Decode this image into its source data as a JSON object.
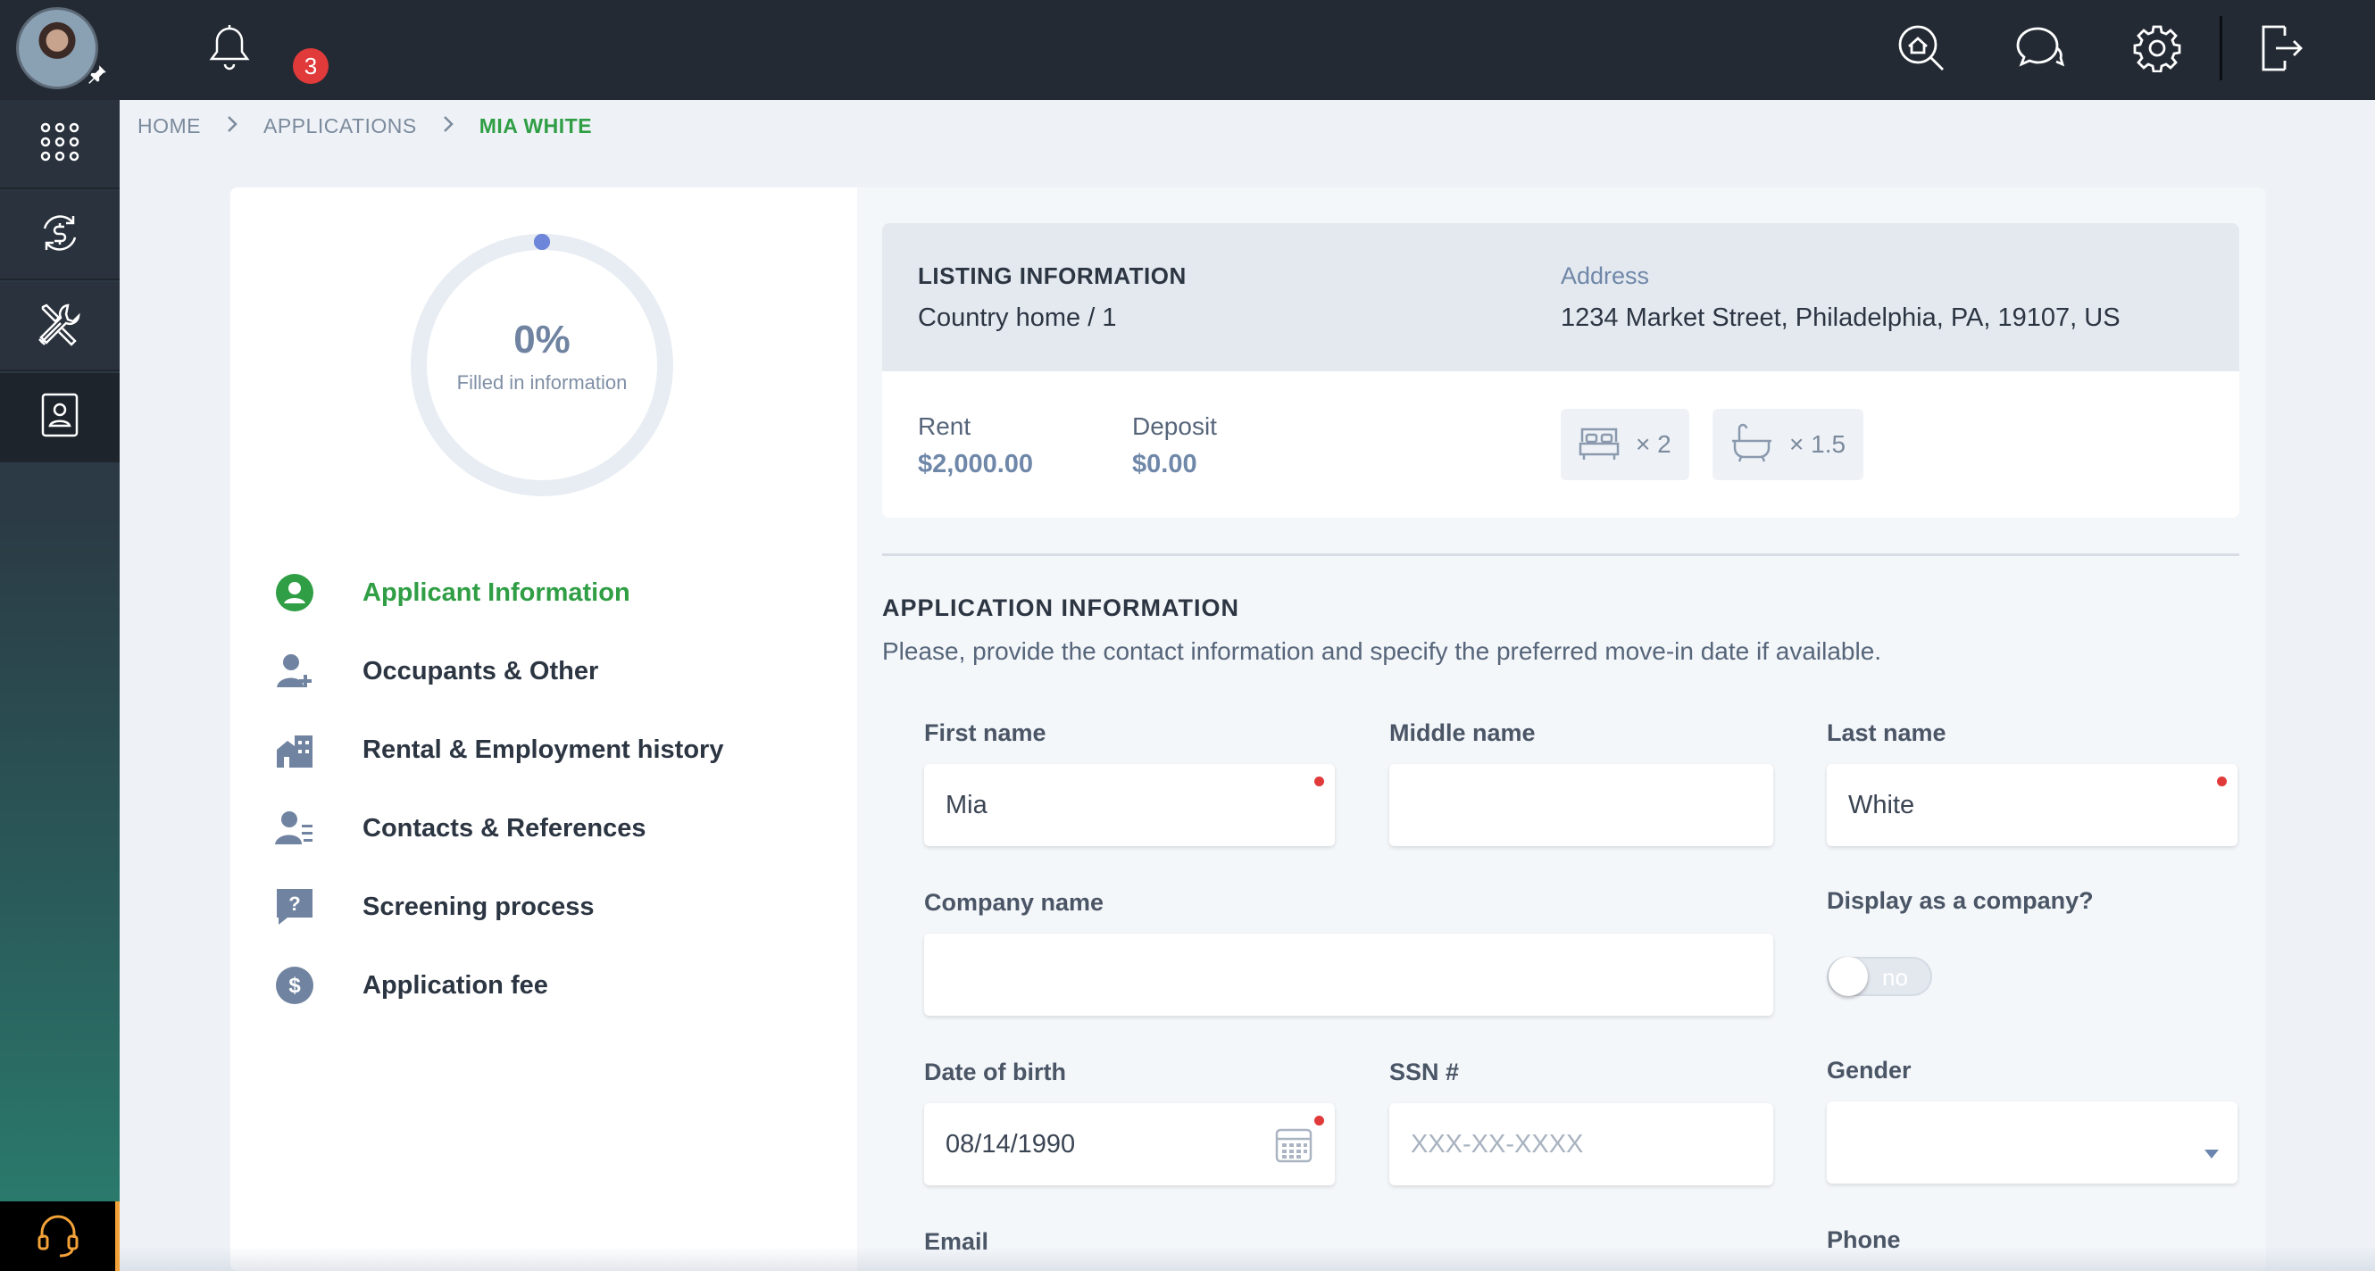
{
  "topbar": {
    "notifications_count": "3",
    "icons": [
      "bell-icon",
      "house-search-icon",
      "chat-icon",
      "gear-icon",
      "logout-icon"
    ]
  },
  "sidebar": {
    "items": [
      "apps-grid-icon",
      "money-cycle-icon",
      "tools-icon",
      "applicant-file-icon"
    ],
    "support": "headset-icon"
  },
  "breadcrumb": {
    "items": [
      "HOME",
      "APPLICATIONS",
      "MIA WHITE"
    ]
  },
  "progress": {
    "value": "0%",
    "fraction": 0,
    "label": "Filled in information"
  },
  "steps": [
    {
      "label": "Applicant Information",
      "icon": "user-circle-icon",
      "active": true
    },
    {
      "label": "Occupants & Other",
      "icon": "user-plus-icon",
      "active": false
    },
    {
      "label": "Rental & Employment history",
      "icon": "building-icon",
      "active": false
    },
    {
      "label": "Contacts & References",
      "icon": "contacts-icon",
      "active": false
    },
    {
      "label": "Screening process",
      "icon": "question-bubble-icon",
      "active": false
    },
    {
      "label": "Application fee",
      "icon": "dollar-circle-icon",
      "active": false
    }
  ],
  "listing": {
    "title": "LISTING INFORMATION",
    "unit": "Country home / 1",
    "address_label": "Address",
    "address": "1234 Market Street, Philadelphia, PA, 19107, US",
    "rent_label": "Rent",
    "rent": "$2,000.00",
    "deposit_label": "Deposit",
    "deposit": "$0.00",
    "beds": "× 2",
    "baths": "× 1.5"
  },
  "application": {
    "title": "APPLICATION INFORMATION",
    "description": "Please, provide the contact information and specify the preferred move-in date if available.",
    "first_name_label": "First name",
    "first_name": "Mia",
    "middle_name_label": "Middle name",
    "middle_name": "",
    "last_name_label": "Last name",
    "last_name": "White",
    "company_label": "Company name",
    "company": "",
    "display_company_label": "Display as a company?",
    "display_company_value": "no",
    "dob_label": "Date of birth",
    "dob": "08/14/1990",
    "ssn_label": "SSN #",
    "ssn_placeholder": "XXX-XX-XXXX",
    "gender_label": "Gender",
    "gender": "",
    "email_label": "Email",
    "phone_label": "Phone"
  },
  "colors": {
    "accent_green": "#2f9e44",
    "topbar": "#232a34",
    "required_dot": "#e03a3a",
    "muted_blue": "#6f87a8"
  }
}
